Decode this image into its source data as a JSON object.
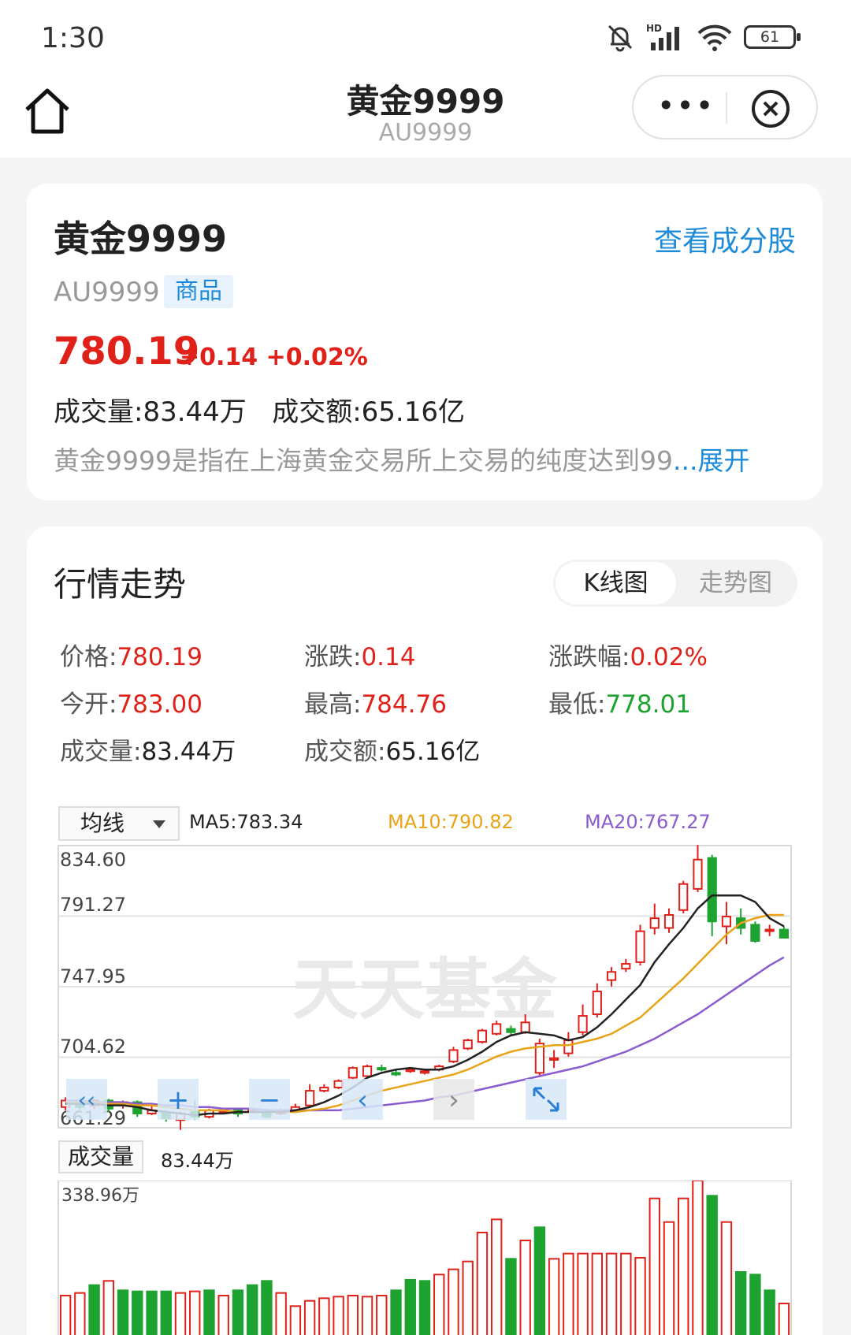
{
  "status_bar": {
    "time": "1:30",
    "battery": "61"
  },
  "nav": {
    "title": "黄金9999",
    "subtitle": "AU9999"
  },
  "info": {
    "name": "黄金9999",
    "view_link": "查看成分股",
    "code": "AU9999",
    "tag": "商品",
    "price": "780.19",
    "change": "+0.14 +0.02%",
    "volume_line": "成交量:83.44万   成交额:65.16亿",
    "description": "黄金9999是指在上海黄金交易所上交易的纯度达到99",
    "expand_label": "...展开"
  },
  "market": {
    "title": "行情走势",
    "tabs": [
      "K线图",
      "走势图"
    ],
    "stats": [
      {
        "label": "价格:",
        "value": "780.19",
        "color": "red"
      },
      {
        "label": "涨跌:",
        "value": "0.14",
        "color": "red"
      },
      {
        "label": "涨跌幅:",
        "value": "0.02%",
        "color": "red"
      },
      {
        "label": "今开:",
        "value": "783.00",
        "color": "red"
      },
      {
        "label": "最高:",
        "value": "784.76",
        "color": "red"
      },
      {
        "label": "最低:",
        "value": "778.01",
        "color": "green"
      },
      {
        "label": "成交量:",
        "value": "83.44万",
        "color": "dark"
      },
      {
        "label": "成交额:",
        "value": "65.16亿",
        "color": "dark"
      }
    ],
    "ma_select": "均线",
    "ma5": "MA5:783.34",
    "ma10": "MA10:790.82",
    "ma20": "MA20:767.27",
    "ma_colors": {
      "ma5": "#222222",
      "ma10": "#e8a317",
      "ma20": "#8a5cd0"
    },
    "watermark": "天天基金",
    "volume_tab": "成交量",
    "volume_value": "83.44万"
  },
  "chart_data": {
    "type": "candlestick",
    "y_ticks": [
      "834.60",
      "791.27",
      "747.95",
      "704.62",
      "661.29"
    ],
    "ylim": [
      661.29,
      834.6
    ],
    "colors": {
      "up": "#e0211a",
      "down": "#1fa330"
    },
    "candles": [
      {
        "o": 674,
        "c": 678,
        "h": 680,
        "l": 672
      },
      {
        "o": 677,
        "c": 674,
        "h": 679,
        "l": 672
      },
      {
        "o": 675,
        "c": 678,
        "h": 679,
        "l": 673
      },
      {
        "o": 678,
        "c": 673,
        "h": 679,
        "l": 671
      },
      {
        "o": 675,
        "c": 677,
        "h": 678,
        "l": 673
      },
      {
        "o": 677,
        "c": 670,
        "h": 678,
        "l": 668
      },
      {
        "o": 670,
        "c": 672,
        "h": 675,
        "l": 669
      },
      {
        "o": 671,
        "c": 667,
        "h": 672,
        "l": 665
      },
      {
        "o": 666,
        "c": 670,
        "h": 671,
        "l": 660
      },
      {
        "o": 671,
        "c": 668,
        "h": 678,
        "l": 666
      },
      {
        "o": 668,
        "c": 672,
        "h": 673,
        "l": 667
      },
      {
        "o": 671,
        "c": 672,
        "h": 673,
        "l": 670
      },
      {
        "o": 672,
        "c": 670,
        "h": 673,
        "l": 668
      },
      {
        "o": 671,
        "c": 672,
        "h": 673,
        "l": 670
      },
      {
        "o": 672,
        "c": 668,
        "h": 673,
        "l": 667
      },
      {
        "o": 670,
        "c": 672,
        "h": 673,
        "l": 669
      },
      {
        "o": 672,
        "c": 674,
        "h": 676,
        "l": 671
      },
      {
        "o": 675,
        "c": 684,
        "h": 688,
        "l": 674
      },
      {
        "o": 684,
        "c": 686,
        "h": 688,
        "l": 683
      },
      {
        "o": 686,
        "c": 690,
        "h": 691,
        "l": 685
      },
      {
        "o": 692,
        "c": 698,
        "h": 699,
        "l": 691
      },
      {
        "o": 693,
        "c": 699,
        "h": 700,
        "l": 692
      },
      {
        "o": 698,
        "c": 697,
        "h": 700,
        "l": 696
      },
      {
        "o": 695,
        "c": 694,
        "h": 697,
        "l": 693
      },
      {
        "o": 696,
        "c": 697,
        "h": 698,
        "l": 695
      },
      {
        "o": 695,
        "c": 696,
        "h": 697,
        "l": 694
      },
      {
        "o": 697,
        "c": 699,
        "h": 700,
        "l": 696
      },
      {
        "o": 702,
        "c": 709,
        "h": 711,
        "l": 701
      },
      {
        "o": 710,
        "c": 715,
        "h": 716,
        "l": 709
      },
      {
        "o": 714,
        "c": 721,
        "h": 722,
        "l": 713
      },
      {
        "o": 719,
        "c": 725,
        "h": 727,
        "l": 718
      },
      {
        "o": 722,
        "c": 720,
        "h": 724,
        "l": 718
      },
      {
        "o": 720,
        "c": 726,
        "h": 731,
        "l": 719
      },
      {
        "o": 695,
        "c": 713,
        "h": 716,
        "l": 693
      },
      {
        "o": 703,
        "c": 704,
        "h": 709,
        "l": 698
      },
      {
        "o": 707,
        "c": 715,
        "h": 720,
        "l": 705
      },
      {
        "o": 720,
        "c": 730,
        "h": 737,
        "l": 718
      },
      {
        "o": 731,
        "c": 745,
        "h": 750,
        "l": 729
      },
      {
        "o": 752,
        "c": 757,
        "h": 760,
        "l": 748
      },
      {
        "o": 759,
        "c": 762,
        "h": 765,
        "l": 757
      },
      {
        "o": 763,
        "c": 782,
        "h": 786,
        "l": 761
      },
      {
        "o": 784,
        "c": 790,
        "h": 799,
        "l": 780
      },
      {
        "o": 784,
        "c": 792,
        "h": 796,
        "l": 781
      },
      {
        "o": 795,
        "c": 811,
        "h": 813,
        "l": 793
      },
      {
        "o": 808,
        "c": 826,
        "h": 835,
        "l": 806
      },
      {
        "o": 827,
        "c": 788,
        "h": 829,
        "l": 779
      },
      {
        "o": 785,
        "c": 791,
        "h": 800,
        "l": 774
      },
      {
        "o": 790,
        "c": 784,
        "h": 796,
        "l": 780
      },
      {
        "o": 786,
        "c": 776,
        "h": 788,
        "l": 775
      },
      {
        "o": 783,
        "c": 783,
        "h": 786,
        "l": 779
      },
      {
        "o": 783,
        "c": 778,
        "h": 785,
        "l": 778
      }
    ],
    "ma5": [
      676,
      676,
      676,
      675,
      675,
      674,
      672,
      671,
      670,
      669,
      670,
      670,
      671,
      671,
      671,
      671,
      672,
      674,
      677,
      681,
      686,
      692,
      695,
      697,
      698,
      697,
      697,
      699,
      703,
      708,
      714,
      718,
      720,
      719,
      718,
      715,
      717,
      723,
      731,
      740,
      749,
      763,
      774,
      784,
      796,
      804,
      804,
      804,
      800,
      790,
      785
    ],
    "ma10": [
      677,
      677,
      677,
      676,
      676,
      675,
      675,
      674,
      673,
      672,
      672,
      672,
      671,
      671,
      671,
      671,
      671,
      672,
      673,
      675,
      678,
      681,
      684,
      686,
      688,
      690,
      692,
      694,
      697,
      701,
      705,
      708,
      710,
      711,
      712,
      712,
      714,
      716,
      719,
      724,
      729,
      737,
      745,
      753,
      762,
      771,
      780,
      787,
      790,
      792,
      792
    ],
    "ma20": [
      678,
      678,
      677,
      677,
      677,
      676,
      676,
      675,
      675,
      674,
      674,
      673,
      673,
      673,
      672,
      672,
      672,
      672,
      672,
      672,
      673,
      674,
      675,
      676,
      677,
      678,
      680,
      681,
      683,
      685,
      687,
      689,
      691,
      693,
      695,
      697,
      699,
      702,
      705,
      708,
      712,
      716,
      721,
      726,
      731,
      737,
      743,
      749,
      755,
      761,
      766
    ],
    "volume_max": "338.96万",
    "volume": [
      {
        "v": 120,
        "up": true
      },
      {
        "v": 125,
        "up": true
      },
      {
        "v": 140,
        "up": false
      },
      {
        "v": 148,
        "up": true
      },
      {
        "v": 130,
        "up": false
      },
      {
        "v": 128,
        "up": false
      },
      {
        "v": 128,
        "up": false
      },
      {
        "v": 128,
        "up": false
      },
      {
        "v": 125,
        "up": true
      },
      {
        "v": 128,
        "up": true
      },
      {
        "v": 130,
        "up": false
      },
      {
        "v": 120,
        "up": true
      },
      {
        "v": 130,
        "up": false
      },
      {
        "v": 140,
        "up": false
      },
      {
        "v": 148,
        "up": false
      },
      {
        "v": 125,
        "up": true
      },
      {
        "v": 100,
        "up": true
      },
      {
        "v": 110,
        "up": true
      },
      {
        "v": 115,
        "up": true
      },
      {
        "v": 118,
        "up": true
      },
      {
        "v": 120,
        "up": true
      },
      {
        "v": 118,
        "up": true
      },
      {
        "v": 120,
        "up": true
      },
      {
        "v": 130,
        "up": false
      },
      {
        "v": 150,
        "up": false
      },
      {
        "v": 148,
        "up": false
      },
      {
        "v": 160,
        "up": true
      },
      {
        "v": 170,
        "up": true
      },
      {
        "v": 185,
        "up": true
      },
      {
        "v": 240,
        "up": true
      },
      {
        "v": 265,
        "up": true
      },
      {
        "v": 190,
        "up": false
      },
      {
        "v": 225,
        "up": true
      },
      {
        "v": 250,
        "up": false
      },
      {
        "v": 190,
        "up": true
      },
      {
        "v": 200,
        "up": true
      },
      {
        "v": 200,
        "up": true
      },
      {
        "v": 200,
        "up": true
      },
      {
        "v": 200,
        "up": true
      },
      {
        "v": 200,
        "up": true
      },
      {
        "v": 192,
        "up": true
      },
      {
        "v": 305,
        "up": true
      },
      {
        "v": 260,
        "up": true
      },
      {
        "v": 305,
        "up": true
      },
      {
        "v": 339,
        "up": true
      },
      {
        "v": 310,
        "up": false
      },
      {
        "v": 260,
        "up": true
      },
      {
        "v": 165,
        "up": false
      },
      {
        "v": 160,
        "up": false
      },
      {
        "v": 130,
        "up": false
      },
      {
        "v": 105,
        "up": true
      }
    ]
  }
}
